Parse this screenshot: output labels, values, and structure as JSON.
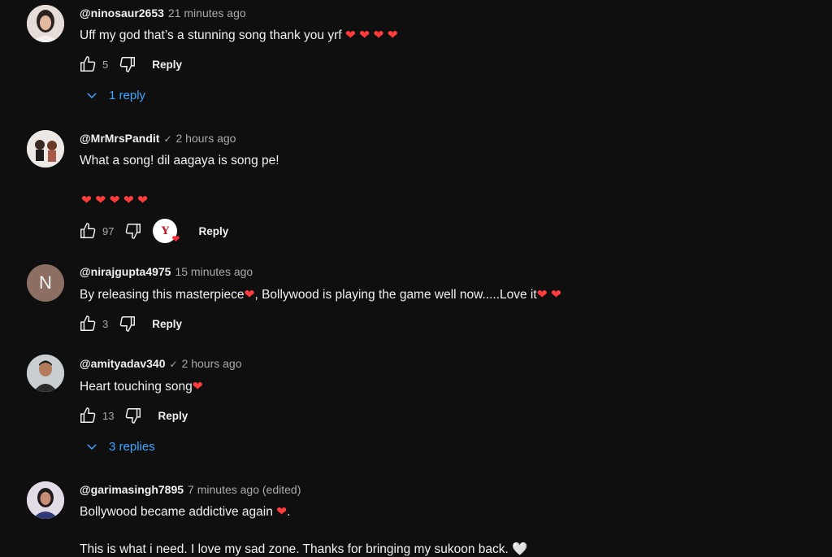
{
  "comments": [
    {
      "author": "@ninosaur2653",
      "time": "21 minutes ago",
      "text": "Uff my god that’s a stunning song thank you yrf",
      "hearts": "❤ ❤ ❤ ❤",
      "likes": "5",
      "reply_label": "Reply",
      "replies_label": "1 reply"
    },
    {
      "author": "@MrMrsPandit",
      "verified": "✓",
      "time": "2 hours ago",
      "text": "What a song! dil aagaya is song pe!",
      "hearts_line": "❤ ❤ ❤ ❤ ❤",
      "likes": "97",
      "reply_label": "Reply"
    },
    {
      "author": "@nirajgupta4975",
      "avatar_letter": "N",
      "time": "15 minutes ago",
      "text_a": "By releasing this masterpiece",
      "text_b": ", Bollywood is playing the game well now.....Love it",
      "hearts": "❤ ❤",
      "likes": "3",
      "reply_label": "Reply"
    },
    {
      "author": "@amityadav340",
      "verified": "✓",
      "time": "2 hours ago",
      "text": "Heart touching song",
      "likes": "13",
      "reply_label": "Reply",
      "replies_label": "3 replies"
    },
    {
      "author": "@garimasingh7895",
      "time": "7 minutes ago (edited)",
      "text": "Bollywood became addictive again",
      "text_end": ".",
      "text2": "This is what i need. I love my sad zone. Thanks for bringing my sukoon back."
    }
  ],
  "icons": {
    "like": "thumbs-up-icon",
    "dislike": "thumbs-down-icon",
    "chevron": "chevron-down-icon",
    "heart": "❤",
    "white_heart": "🤍"
  },
  "colors": {
    "background": "#0f0f0f",
    "link": "#3ea6ff",
    "heart": "#ff3b3b"
  }
}
